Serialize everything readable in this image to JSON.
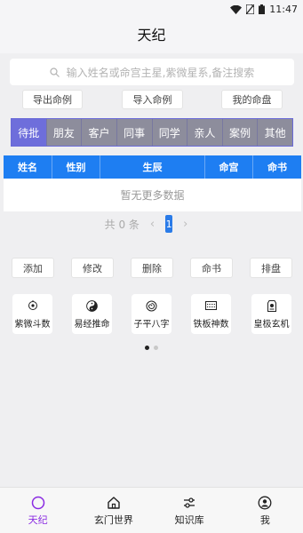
{
  "status_bar": {
    "time": "11:47"
  },
  "header": {
    "title": "天纪"
  },
  "search": {
    "placeholder": "输入姓名或命宫主星,紫微星系,备注搜索"
  },
  "top_buttons": {
    "export": "导出命例",
    "import": "导入命例",
    "my_chart": "我的命盘"
  },
  "tabs": [
    {
      "label": "待批",
      "active": true
    },
    {
      "label": "朋友"
    },
    {
      "label": "客户"
    },
    {
      "label": "同事"
    },
    {
      "label": "同学"
    },
    {
      "label": "亲人"
    },
    {
      "label": "案例"
    },
    {
      "label": "其他"
    }
  ],
  "table": {
    "columns": [
      "姓名",
      "性别",
      "生辰",
      "命宫",
      "命书"
    ],
    "empty_text": "暂无更多数据"
  },
  "pagination": {
    "total_text": "共 0 条",
    "current_page": "1",
    "prev": "‹",
    "next": "›"
  },
  "actions": {
    "add": "添加",
    "edit": "修改",
    "delete": "删除",
    "book": "命书",
    "arrange": "排盘"
  },
  "tools": [
    {
      "label": "紫微斗数",
      "icon": "purple-star-icon"
    },
    {
      "label": "易经推命",
      "icon": "yin-yang-icon"
    },
    {
      "label": "子平八字",
      "icon": "spiral-icon"
    },
    {
      "label": "铁板神数",
      "icon": "calculator-icon"
    },
    {
      "label": "皇极玄机",
      "icon": "emblem-icon"
    }
  ],
  "carousel": {
    "count": 2,
    "active_index": 0
  },
  "bottom_nav": [
    {
      "label": "天纪",
      "active": true,
      "icon": "circle-icon",
      "color": "#8a2be2"
    },
    {
      "label": "玄门世界",
      "icon": "home-icon"
    },
    {
      "label": "知识库",
      "icon": "sliders-icon"
    },
    {
      "label": "我",
      "icon": "user-icon"
    }
  ],
  "colors": {
    "accent": "#6e6edb",
    "table_header": "#1e7ef2",
    "tab_bar": "#8d8d9c",
    "active_nav": "#8a2be2"
  }
}
